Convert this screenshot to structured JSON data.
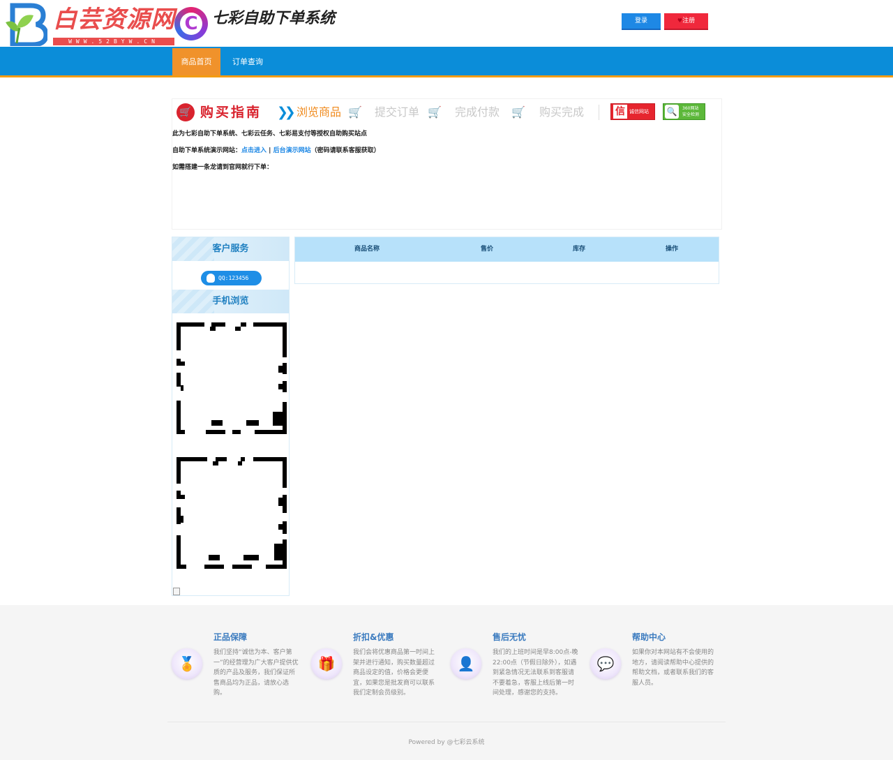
{
  "header": {
    "brand_main": "白芸资源网",
    "brand_url": "WWW.52BYW.CN",
    "logo_letter": "C",
    "system_title": "七彩自助下单系统",
    "login_label": "登录",
    "register_label": "注册"
  },
  "nav": {
    "items": [
      {
        "label": "商品首页",
        "active": true
      },
      {
        "label": "订单查询",
        "active": false
      }
    ],
    "colors": {
      "bar": "#0b8dd9",
      "active": "#f0922b",
      "underline": "#f39c12"
    }
  },
  "guide": {
    "title": "购买指南",
    "steps": [
      "浏览商品",
      "提交订单",
      "完成付款",
      "购买完成"
    ],
    "badge_xin_big": "信",
    "badge_xin_text": "诚信网站",
    "badge_360_text_1": "360网站",
    "badge_360_text_2": "安全检测",
    "line1": "此为七彩自助下单系统、七彩云任务、七彩易支付等授权自助购买站点",
    "line2_prefix": "自助下单系统演示网站：",
    "line2_link1": "点击进入",
    "line2_sep": " | ",
    "line2_link2": "后台演示网站",
    "line2_suffix": "（密码请联系客服获取）",
    "line3": "如需搭建一条龙请到官网就行下单："
  },
  "sidebar": {
    "service_title": "客户服务",
    "qq_label": "QQ:123456",
    "mobile_title": "手机浏览"
  },
  "product_table": {
    "headers": [
      "商品名称",
      "售价",
      "库存",
      "操作"
    ],
    "rows": []
  },
  "footer": {
    "features": [
      {
        "icon": "certified-icon",
        "title": "正品保障",
        "desc": "我们坚持“诚信为本、客户第一”的经营理为广大客户提供优质的产品及服务，我们保证所售商品均为正品，请放心选购。"
      },
      {
        "icon": "gift-icon",
        "title": "折扣&优惠",
        "desc": "我们会将优惠商品第一时间上架并进行通知，购买数量超过商品设定的值，价格会更便宜，如果您是批发商可以联系我们定制会员级别。"
      },
      {
        "icon": "support-user-icon",
        "title": "售后无忧",
        "desc": "我们的上班时间是早8:00点-晚22:00点（节假日除外），如遇到紧急情况无法联系到客服请不要着急，客服上线后第一时间处理，感谢您的支持。"
      },
      {
        "icon": "chat-icon",
        "title": "帮助中心",
        "desc": "如果你对本网站有不会使用的地方，请阅读帮助中心提供的帮助文档，或者联系我们的客服人员。"
      }
    ],
    "powered": "Powered by @七彩云系统"
  }
}
